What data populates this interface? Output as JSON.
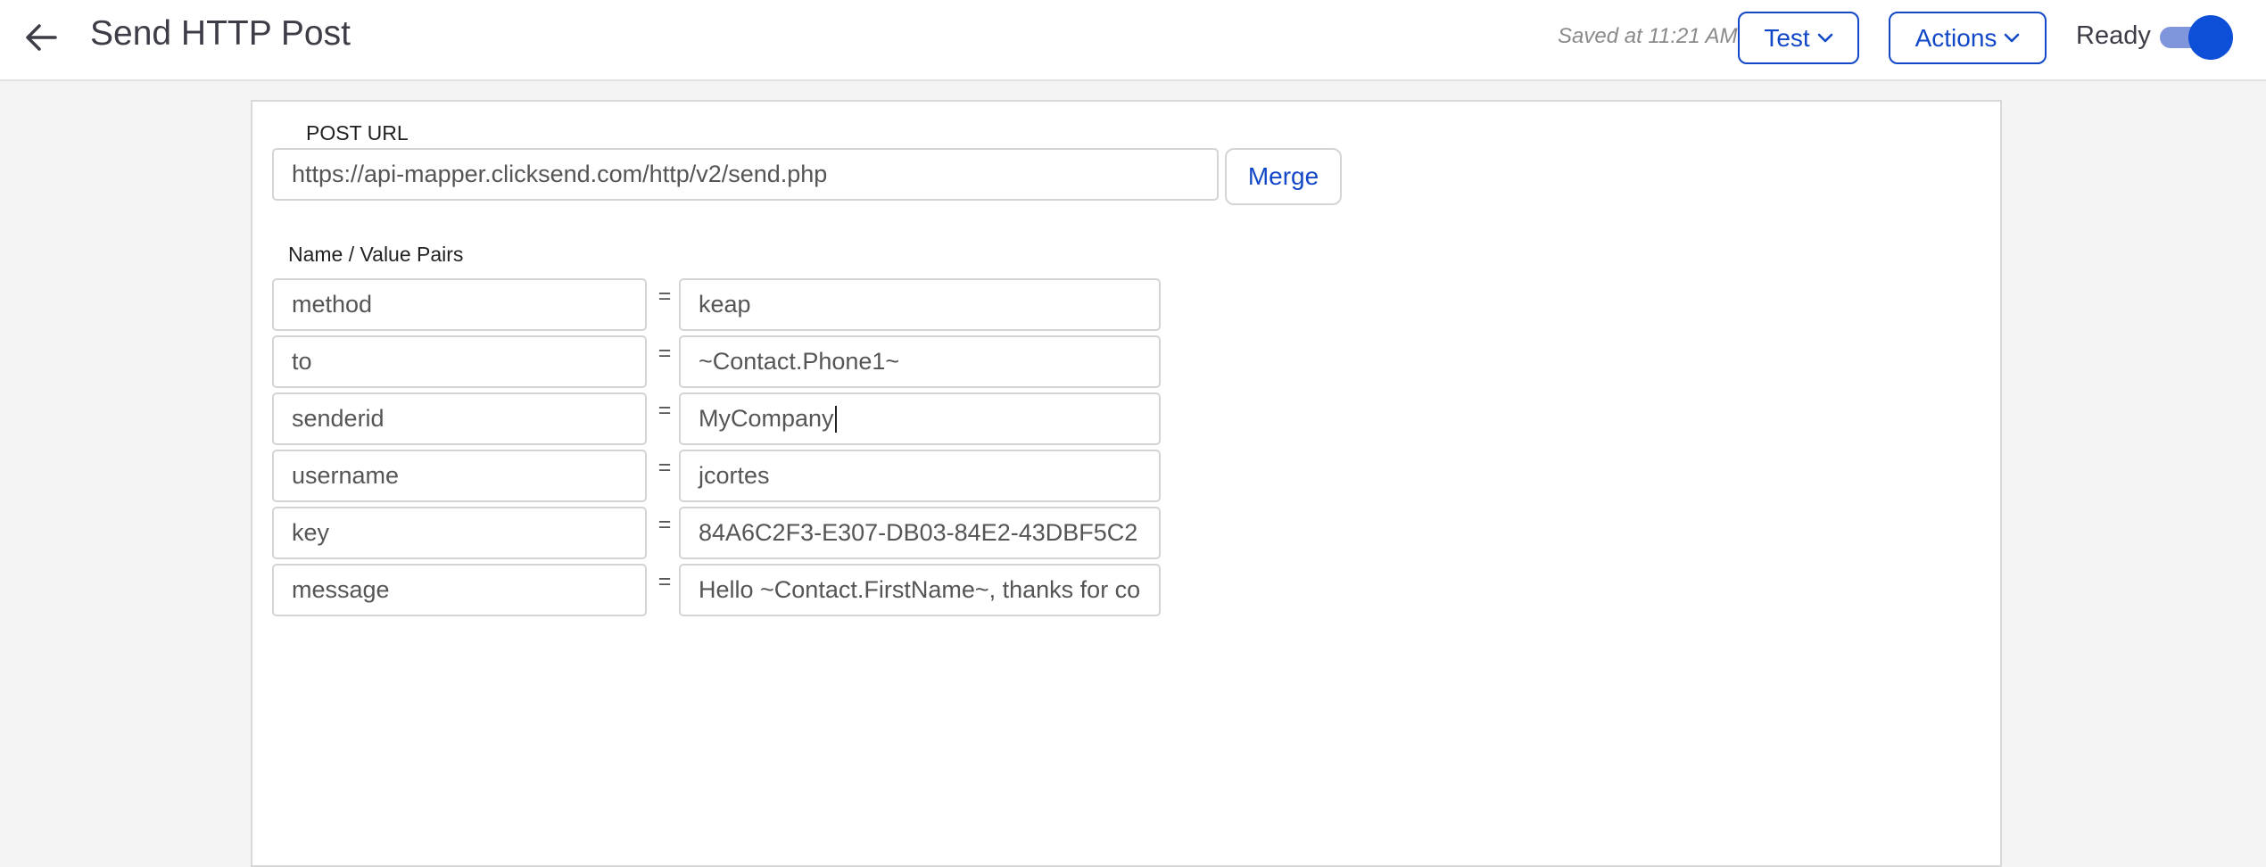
{
  "header": {
    "title": "Send HTTP Post",
    "saved_text": "Saved at 11:21 AM",
    "test_label": "Test",
    "actions_label": "Actions",
    "ready_label": "Ready",
    "ready_enabled": true
  },
  "form": {
    "post_url_label": "POST URL",
    "post_url_value": "https://api-mapper.clicksend.com/http/v2/send.php",
    "merge_label": "Merge",
    "pairs_label": "Name / Value Pairs",
    "equals_sign": "=",
    "pairs": [
      {
        "name": "method",
        "value": "keap"
      },
      {
        "name": "to",
        "value": "~Contact.Phone1~"
      },
      {
        "name": "senderid",
        "value": "MyCompany"
      },
      {
        "name": "username",
        "value": "jcortes"
      },
      {
        "name": "key",
        "value": "84A6C2F3-E307-DB03-84E2-43DBF5C2"
      },
      {
        "name": "message",
        "value": "Hello ~Contact.FirstName~, thanks for co"
      }
    ]
  },
  "colors": {
    "accent": "#1248c7",
    "toggle_on": "#0d4fd7"
  },
  "icons": {
    "back": "arrow-left-icon",
    "dropdown": "chevron-down-icon"
  }
}
